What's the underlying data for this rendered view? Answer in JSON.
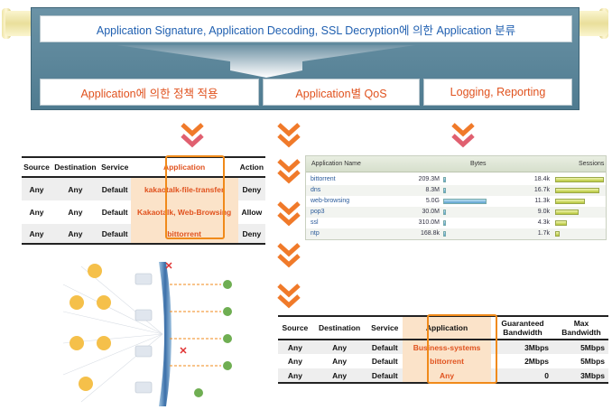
{
  "banner": {
    "signature": "Application Signature, Application Decoding, SSL Decryption에 의한 Application 분류",
    "policy": "Application에 의한 정책 적용",
    "qos": "Application별 QoS",
    "logging": "Logging, Reporting"
  },
  "policy_table": {
    "headers": [
      "Source",
      "Destination",
      "Service",
      "Application",
      "Action"
    ],
    "rows": [
      [
        "Any",
        "Any",
        "Default",
        "kakaotalk-file-transfer",
        "Deny"
      ],
      [
        "Any",
        "Any",
        "Default",
        "Kakaotalk, Web-Browsing",
        "Allow"
      ],
      [
        "Any",
        "Any",
        "Default",
        "bittorrent",
        "Deny"
      ]
    ]
  },
  "monitor": {
    "headers": [
      "Application Name",
      "Bytes",
      "Sessions"
    ],
    "rows": [
      {
        "name": "bittorrent",
        "bytes": "209.3M",
        "sessions": "18.4k",
        "bytes_frac": 0.04,
        "sess_frac": 1.0
      },
      {
        "name": "dns",
        "bytes": "8.3M",
        "sessions": "16.7k",
        "bytes_frac": 0.02,
        "sess_frac": 0.9
      },
      {
        "name": "web-browsing",
        "bytes": "5.0G",
        "sessions": "11.3k",
        "bytes_frac": 1.0,
        "sess_frac": 0.62
      },
      {
        "name": "pop3",
        "bytes": "30.0M",
        "sessions": "9.0k",
        "bytes_frac": 0.01,
        "sess_frac": 0.49
      },
      {
        "name": "ssl",
        "bytes": "310.0M",
        "sessions": "4.3k",
        "bytes_frac": 0.06,
        "sess_frac": 0.24
      },
      {
        "name": "ntp",
        "bytes": "168.8k",
        "sessions": "1.7k",
        "bytes_frac": 0.01,
        "sess_frac": 0.1
      }
    ]
  },
  "qos_table": {
    "headers": [
      "Source",
      "Destination",
      "Service",
      "Application",
      "Guaranteed Bandwidth",
      "Max Bandwidth"
    ],
    "rows": [
      [
        "Any",
        "Any",
        "Default",
        "Business-systems",
        "3Mbps",
        "5Mbps"
      ],
      [
        "Any",
        "Any",
        "Default",
        "bittorrent",
        "2Mbps",
        "5Mbps"
      ],
      [
        "Any",
        "Any",
        "Default",
        "Any",
        "0",
        "3Mbps"
      ]
    ]
  },
  "colors": {
    "accent": "#e0521e",
    "chevron": "#f07a2a",
    "banner": "#5a8599",
    "highlight": "#f08a1a"
  }
}
